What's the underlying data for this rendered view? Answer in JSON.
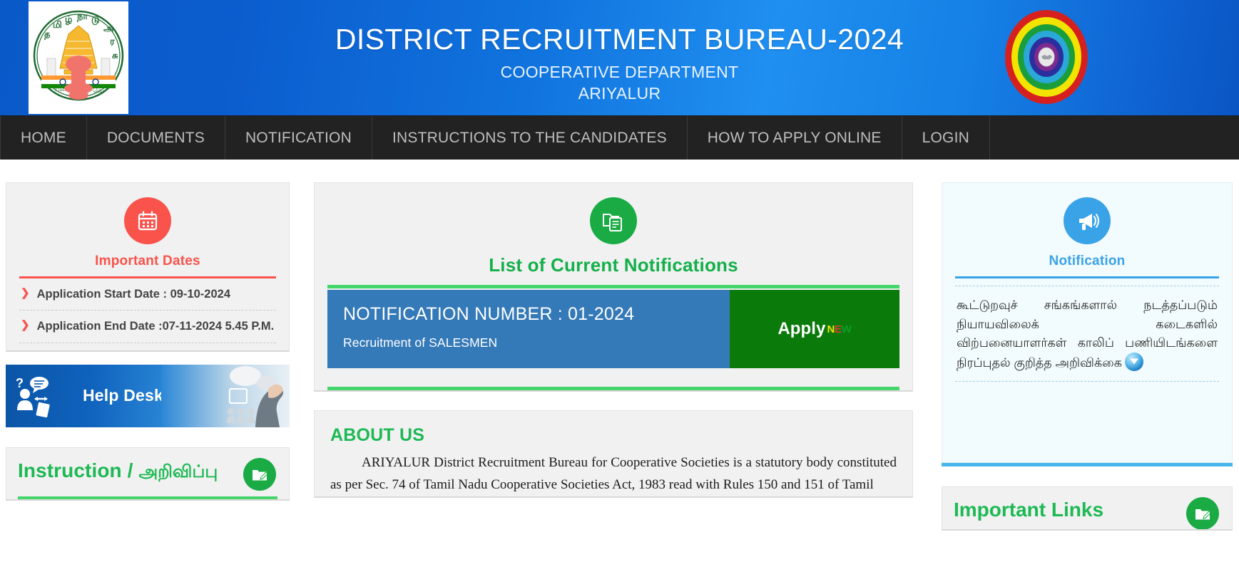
{
  "header": {
    "title": "DISTRICT RECRUITMENT BUREAU-2024",
    "subtitle": "COOPERATIVE DEPARTMENT",
    "district": "ARIYALUR",
    "left_emblem_name": "tamil-nadu-government-emblem",
    "right_emblem_name": "cooperative-department-emblem",
    "gradient_start": "#0a59c9",
    "gradient_mid": "#1f8ff0",
    "gradient_end": "#0a55c4"
  },
  "nav": {
    "background": "#222222",
    "text_color": "#bfbfbf",
    "items": [
      {
        "label": "HOME"
      },
      {
        "label": "DOCUMENTS"
      },
      {
        "label": "NOTIFICATION"
      },
      {
        "label": "INSTRUCTIONS TO THE CANDIDATES"
      },
      {
        "label": "HOW TO APPLY ONLINE"
      },
      {
        "label": "LOGIN"
      }
    ]
  },
  "left": {
    "important_dates": {
      "icon": "calendar-icon",
      "heading": "Important Dates",
      "accent": "#f9534c",
      "rows": [
        {
          "text": "Application Start Date : 09-10-2024"
        },
        {
          "text": "Application End Date :07-11-2024 5.45 P.M."
        }
      ]
    },
    "help_desk": {
      "label": "Help Desk",
      "icon": "help-desk-icon"
    },
    "instruction": {
      "title_en": "Instruction /",
      "title_ta": "அறிவிப்பு",
      "badge_icon": "folder-edit-icon",
      "accent": "#1db954"
    }
  },
  "center": {
    "notifications": {
      "icon": "documents-icon",
      "heading": "List of Current Notifications",
      "accent": "#14b04a",
      "rows": [
        {
          "number": "NOTIFICATION NUMBER : 01-2024",
          "description": "Recruitment of SALESMEN",
          "apply_label": "Apply",
          "badge_new": "NEW",
          "apply_color": "#0a7a0a",
          "row_color": "#3479b8"
        }
      ]
    },
    "about": {
      "title": "ABOUT US",
      "body": "ARIYALUR District Recruitment Bureau for Cooperative Societies is a statutory body constituted as per Sec. 74 of Tamil Nadu Cooperative Societies Act, 1983 read with Rules 150 and 151 of Tamil"
    }
  },
  "right": {
    "notification": {
      "icon": "megaphone-icon",
      "heading": "Notification",
      "accent": "#3aa3e8",
      "tamil_text": "கூட்டுறவுச் சங்கங்களால் நடத்தப்படும் நியாயவிலைக் கடைகளில் விற்பனையாளர்கள் காலிப் பணியிடங்களை நிரப்புதல் குறித்த அறிவிக்கை",
      "download_icon": "download-icon"
    },
    "important_links": {
      "title": "Important Links",
      "badge_icon": "folder-edit-icon",
      "accent": "#1db954"
    }
  }
}
